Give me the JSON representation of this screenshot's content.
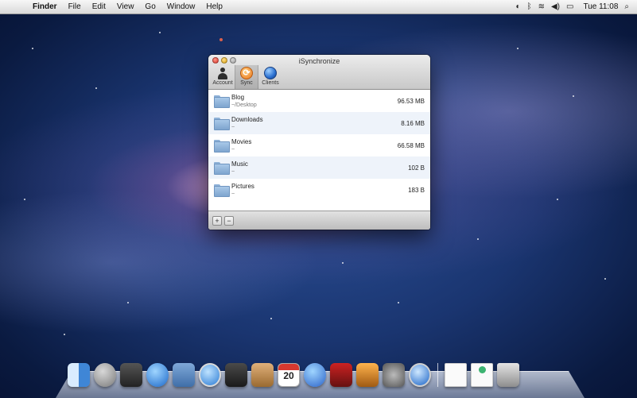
{
  "menubar": {
    "app_name": "Finder",
    "items": [
      "File",
      "Edit",
      "View",
      "Go",
      "Window",
      "Help"
    ],
    "clock": "Tue 11:08"
  },
  "window": {
    "title": "iSynchronize",
    "toolbar": [
      {
        "label": "Account",
        "icon": "person-icon"
      },
      {
        "label": "Sync",
        "icon": "sync-icon",
        "selected": true
      },
      {
        "label": "Clients",
        "icon": "globe-icon"
      }
    ],
    "folders": [
      {
        "name": "Blog",
        "path": "~/Desktop",
        "size": "96.53 MB"
      },
      {
        "name": "Downloads",
        "path": "~",
        "size": "8.16 MB"
      },
      {
        "name": "Movies",
        "path": "~",
        "size": "66.58 MB"
      },
      {
        "name": "Music",
        "path": "~",
        "size": "102 B"
      },
      {
        "name": "Pictures",
        "path": "~",
        "size": "183 B"
      }
    ],
    "add_label": "+",
    "remove_label": "−"
  },
  "dock": {
    "ical_day": "20",
    "items": [
      "finder-icon",
      "launchpad-icon",
      "mission-control-icon",
      "app-store-icon",
      "mail-icon",
      "safari-icon",
      "facetime-icon",
      "address-book-icon",
      "ical-icon",
      "itunes-icon",
      "photo-booth-icon",
      "iphoto-icon",
      "system-preferences-icon",
      "quicktime-icon",
      "document-icon",
      "download-document-icon",
      "trash-icon"
    ]
  }
}
